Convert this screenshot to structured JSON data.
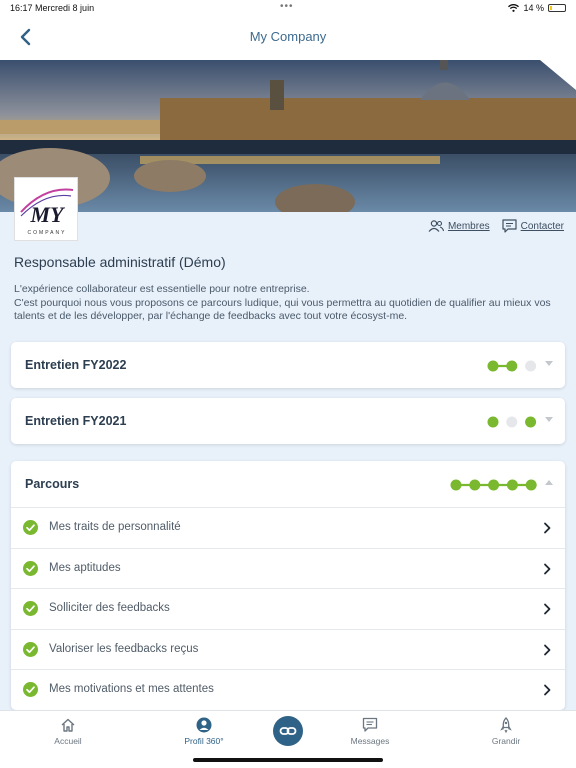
{
  "status": {
    "time": "16:17",
    "date": "Mercredi 8 juin",
    "battery": "14 %",
    "battery_level": 0.14
  },
  "nav": {
    "title": "My Company"
  },
  "logo": {
    "main": "MY",
    "sub": "COMPANY"
  },
  "links": {
    "members": "Membres",
    "contact": "Contacter"
  },
  "role": "Responsable administratif (Démo)",
  "intro": "L'expérience collaborateur est essentielle pour notre entreprise.\nC'est pourquoi nous vous proposons ce parcours ludique, qui vous permettra au quotidien de qualifier au mieux vos talents et de les développer, par l'échange de feedbacks avec tout votre écosyst-me.",
  "colors": {
    "accent": "#2f6287",
    "progress_done": "#7ab830",
    "progress_todo": "#e5e7ea",
    "check": "#7ab830"
  },
  "cards": [
    {
      "title": "Entretien FY2022",
      "steps": [
        true,
        true,
        false
      ],
      "expanded": false
    },
    {
      "title": "Entretien FY2021",
      "steps": [
        true,
        false,
        true
      ],
      "expanded": false
    }
  ],
  "parcours": {
    "title": "Parcours",
    "steps": [
      true,
      true,
      true,
      true,
      true
    ],
    "expanded": true,
    "items": [
      {
        "label": "Mes traits de personnalité",
        "done": true
      },
      {
        "label": "Mes aptitudes",
        "done": true
      },
      {
        "label": "Solliciter des feedbacks",
        "done": true
      },
      {
        "label": "Valoriser les feedbacks reçus",
        "done": true
      },
      {
        "label": "Mes motivations et mes attentes",
        "done": true
      }
    ]
  },
  "tabs": [
    {
      "label": "Accueil",
      "icon": "home-icon"
    },
    {
      "label": "Profil 360°",
      "icon": "profile-icon",
      "active": true
    },
    {
      "label": "",
      "icon": "link-icon"
    },
    {
      "label": "Messages",
      "icon": "message-icon"
    },
    {
      "label": "Grandir",
      "icon": "rocket-icon"
    }
  ]
}
